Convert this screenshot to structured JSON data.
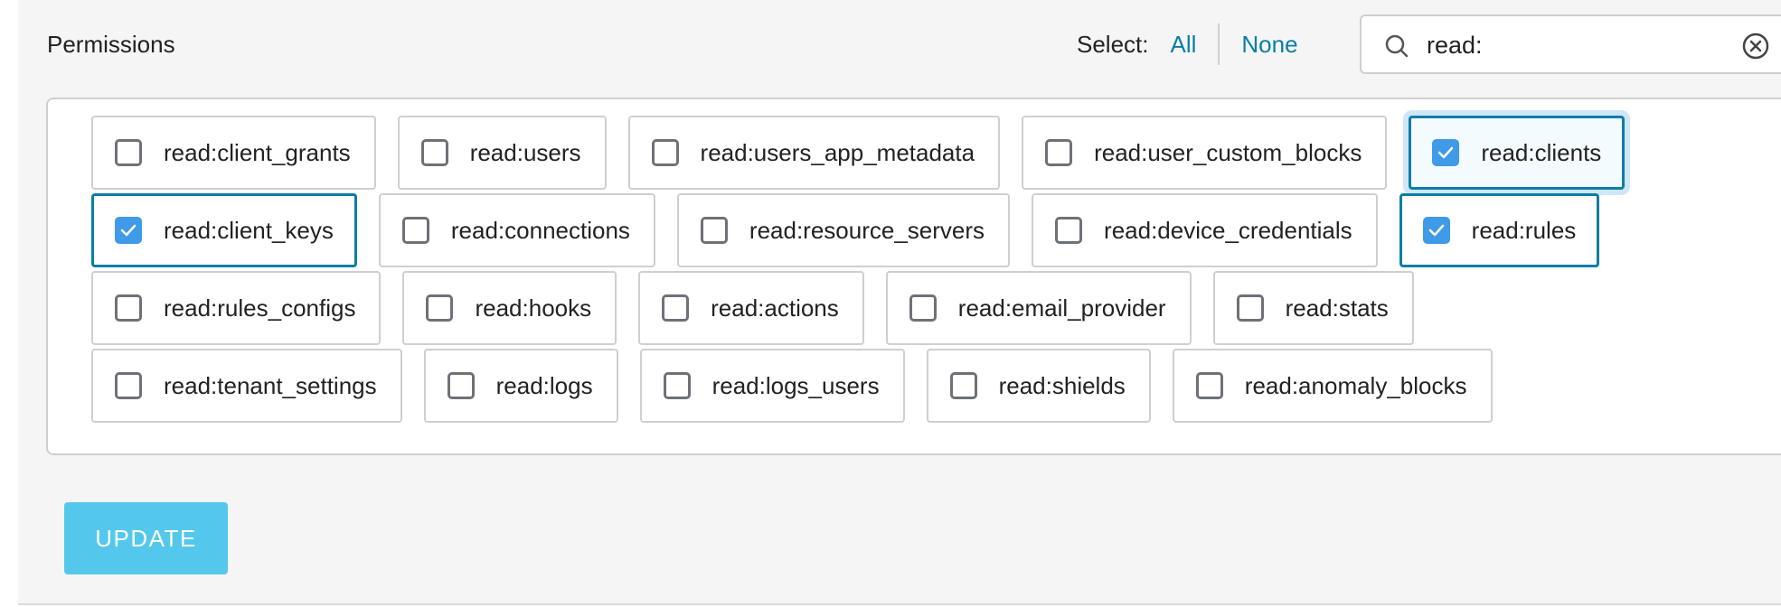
{
  "permissions": {
    "title": "Permissions",
    "select_label": "Select:",
    "select_all": "All",
    "select_none": "None",
    "search": {
      "value": "read:",
      "icon": "search-icon",
      "clear_icon": "close-circle-icon"
    },
    "rows": [
      [
        {
          "label": "read:client_grants",
          "checked": false
        },
        {
          "label": "read:users",
          "checked": false
        },
        {
          "label": "read:users_app_metadata",
          "checked": false
        },
        {
          "label": "read:user_custom_blocks",
          "checked": false
        },
        {
          "label": "read:clients",
          "checked": true,
          "focused": true
        }
      ],
      [
        {
          "label": "read:client_keys",
          "checked": true
        },
        {
          "label": "read:connections",
          "checked": false
        },
        {
          "label": "read:resource_servers",
          "checked": false
        },
        {
          "label": "read:device_credentials",
          "checked": false
        },
        {
          "label": "read:rules",
          "checked": true
        }
      ],
      [
        {
          "label": "read:rules_configs",
          "checked": false
        },
        {
          "label": "read:hooks",
          "checked": false
        },
        {
          "label": "read:actions",
          "checked": false
        },
        {
          "label": "read:email_provider",
          "checked": false
        },
        {
          "label": "read:stats",
          "checked": false
        }
      ],
      [
        {
          "label": "read:tenant_settings",
          "checked": false
        },
        {
          "label": "read:logs",
          "checked": false
        },
        {
          "label": "read:logs_users",
          "checked": false
        },
        {
          "label": "read:shields",
          "checked": false
        },
        {
          "label": "read:anomaly_blocks",
          "checked": false
        }
      ]
    ]
  },
  "update_button": "UPDATE",
  "colors": {
    "accent": "#0a7ea6",
    "checkbox_checked": "#3f9ae8",
    "update_button": "#54c8ec"
  }
}
